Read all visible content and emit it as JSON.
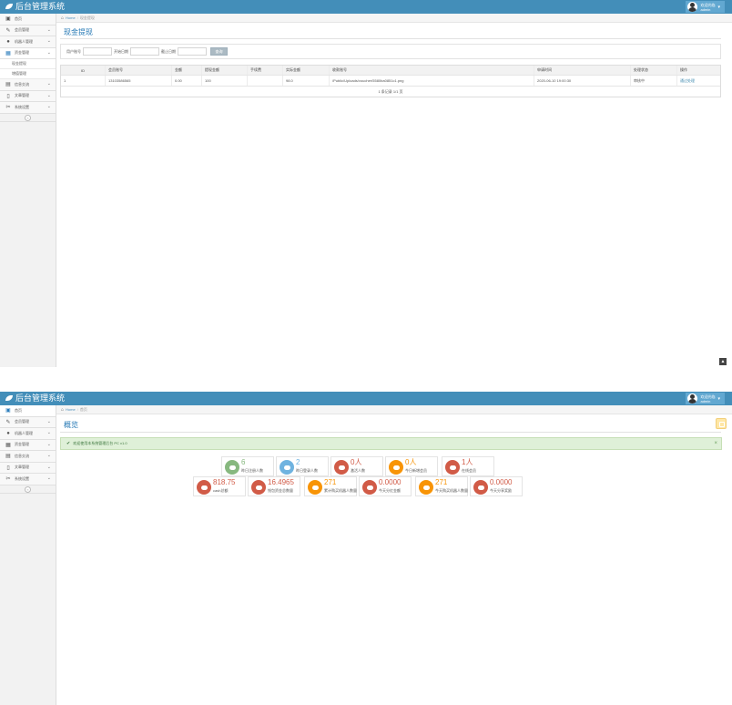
{
  "app": {
    "title": "后台管理系统"
  },
  "user": {
    "greeting": "欢迎光临",
    "name": "admin"
  },
  "sidebar_1": [
    {
      "icon": "dashboard-icon",
      "glyph": "▣",
      "label": "首页",
      "chevron": ""
    },
    {
      "icon": "pencil-icon",
      "glyph": "✎",
      "label": "会员管理",
      "chevron": "⌄"
    },
    {
      "icon": "robot-icon",
      "glyph": "●",
      "label": "机器人管理",
      "chevron": "⌄"
    },
    {
      "icon": "calendar-icon",
      "glyph": "▦",
      "label": "资金管理",
      "chevron": "⌄"
    }
  ],
  "sidebar_1_sub": [
    "现金提现",
    "增值管理"
  ],
  "sidebar_1_rest": [
    {
      "icon": "table-icon",
      "glyph": "▤",
      "label": "信息交流",
      "chevron": "⌄"
    },
    {
      "icon": "file-icon",
      "glyph": "▯",
      "label": "文章管理",
      "chevron": "⌄"
    },
    {
      "icon": "tools-icon",
      "glyph": "✂",
      "label": "系统设置",
      "chevron": "⌄"
    }
  ],
  "sidebar_2": [
    {
      "icon": "dashboard-icon",
      "glyph": "▣",
      "label": "首页",
      "chevron": ""
    },
    {
      "icon": "pencil-icon",
      "glyph": "✎",
      "label": "会员管理",
      "chevron": "⌄"
    },
    {
      "icon": "robot-icon",
      "glyph": "●",
      "label": "机器人管理",
      "chevron": "⌄"
    },
    {
      "icon": "calendar-icon",
      "glyph": "▦",
      "label": "资金管理",
      "chevron": "⌄"
    },
    {
      "icon": "table-icon",
      "glyph": "▤",
      "label": "信息交流",
      "chevron": "⌄"
    },
    {
      "icon": "file-icon",
      "glyph": "▯",
      "label": "文章管理",
      "chevron": "⌄"
    },
    {
      "icon": "tools-icon",
      "glyph": "✂",
      "label": "系统设置",
      "chevron": "⌄"
    }
  ],
  "collapse_glyph": "«",
  "breadcrumb_1": {
    "home": "Home",
    "current": "现金提现"
  },
  "breadcrumb_2": {
    "home": "Home",
    "current": "首页"
  },
  "withdraw": {
    "title": "现金提现",
    "filter": {
      "phone_label": "用户账号",
      "start_label": "开始日期",
      "end_label": "截止日期",
      "search_button": "查询"
    },
    "columns": [
      "ID",
      "会员账号",
      "金额",
      "提现金额",
      "手续费",
      "实际金额",
      "收款账号",
      "申请时间",
      "处理状态",
      "操作"
    ],
    "rows": [
      {
        "id": "1",
        "account": "13103586565",
        "amount": "0.00",
        "withdraw": "100",
        "fee": "",
        "actual": "98.0",
        "receipt": "/Public/Uploads/voucher/5580ba0851c1.png",
        "time": "2020-06-10 19:00:30",
        "status": "审核中",
        "action": "通过处理"
      }
    ],
    "pager": "1 条记录 1/1 页"
  },
  "dashboard": {
    "title": "概览",
    "alert": "欢迎使用本系统管理后台 PC v1.0",
    "close": "×",
    "stats": [
      {
        "value": "6",
        "label": "昨日注册人数",
        "color": "#87b87f"
      },
      {
        "value": "2",
        "label": "昨日登录人数",
        "color": "#6fb3e0"
      },
      {
        "value": "0人",
        "label": "激活人数",
        "color": "#d15b47"
      },
      {
        "value": "0人",
        "label": "今日新增会员",
        "color": "#f89406"
      },
      {
        "value": "1人",
        "label": "在线会员",
        "color": "#d15b47"
      },
      {
        "value": "818.75",
        "label": "cash总额",
        "color": "#d15b47"
      },
      {
        "value": "16.4965",
        "label": "钱包资金总数量",
        "color": "#d15b47"
      },
      {
        "value": "271",
        "label": "累计购买机器人数量",
        "color": "#f89406"
      },
      {
        "value": "0.0000",
        "label": "今天分红金额",
        "color": "#d15b47"
      },
      {
        "value": "271",
        "label": "今天购买机器人数量",
        "color": "#f89406"
      },
      {
        "value": "0.0000",
        "label": "今天分享奖励",
        "color": "#d15b47"
      }
    ]
  }
}
